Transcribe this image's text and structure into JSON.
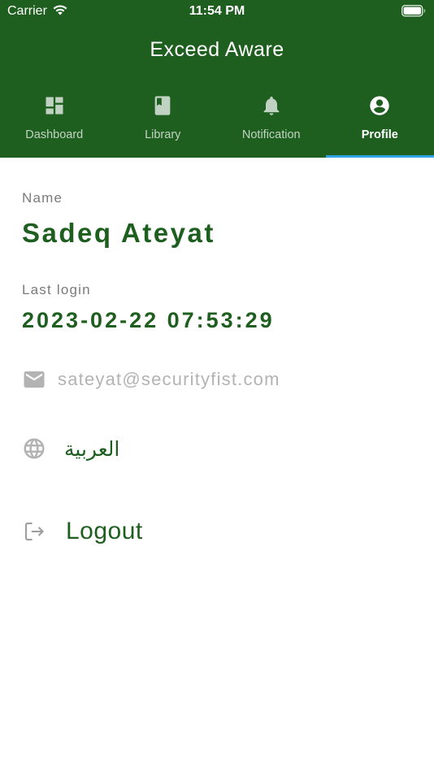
{
  "status_bar": {
    "carrier": "Carrier",
    "time": "11:54 PM"
  },
  "app": {
    "title": "Exceed Aware"
  },
  "tabs": [
    {
      "label": "Dashboard",
      "icon": "dashboard-icon",
      "active": false
    },
    {
      "label": "Library",
      "icon": "book-icon",
      "active": false
    },
    {
      "label": "Notification",
      "icon": "bell-icon",
      "active": false
    },
    {
      "label": "Profile",
      "icon": "account-circle-icon",
      "active": true
    }
  ],
  "profile": {
    "name_label": "Name",
    "name": "Sadeq Ateyat",
    "last_login_label": "Last login",
    "last_login": "2023-02-22 07:53:29",
    "email": "sateyat@securityfist.com",
    "language": "العربية",
    "logout": "Logout"
  },
  "colors": {
    "primary": "#1e5f20",
    "accent": "#2ea3e6",
    "muted": "#b3b3b3"
  }
}
